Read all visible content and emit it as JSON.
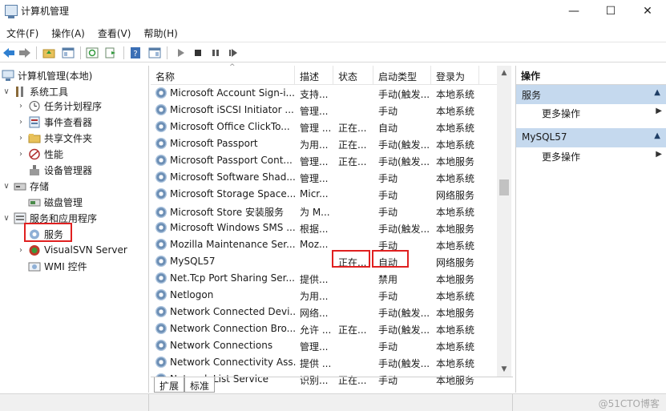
{
  "window": {
    "title": "计算机管理",
    "min_glyph": "—",
    "max_glyph": "☐",
    "close_glyph": "✕"
  },
  "menu": [
    "文件(F)",
    "操作(A)",
    "查看(V)",
    "帮助(H)"
  ],
  "toolbar_icons": [
    "back-icon",
    "forward-icon",
    "up-folder-icon",
    "show-tree-icon",
    "refresh-icon",
    "export-icon",
    "help-icon",
    "view-icon",
    "play-icon",
    "stop-icon",
    "pause-icon",
    "restart-icon"
  ],
  "tree": {
    "root": "计算机管理(本地)",
    "system_tools": "系统工具",
    "task_scheduler": "任务计划程序",
    "event_viewer": "事件查看器",
    "shared_folders": "共享文件夹",
    "performance": "性能",
    "device_manager": "设备管理器",
    "storage": "存储",
    "disk_management": "磁盘管理",
    "services_apps": "服务和应用程序",
    "services": "服务",
    "visualsvn": "VisualSVN Server",
    "wmi": "WMI 控件"
  },
  "columns": {
    "name": "名称",
    "desc": "描述",
    "status": "状态",
    "startup": "启动类型",
    "logon": "登录为"
  },
  "services": [
    {
      "name": "Microsoft Account Sign-i...",
      "desc": "支持...",
      "status": "",
      "startup": "手动(触发...",
      "logon": "本地系统"
    },
    {
      "name": "Microsoft iSCSI Initiator ...",
      "desc": "管理...",
      "status": "",
      "startup": "手动",
      "logon": "本地系统"
    },
    {
      "name": "Microsoft Office ClickTo...",
      "desc": "管理 ...",
      "status": "正在...",
      "startup": "自动",
      "logon": "本地系统"
    },
    {
      "name": "Microsoft Passport",
      "desc": "为用...",
      "status": "正在...",
      "startup": "手动(触发...",
      "logon": "本地系统"
    },
    {
      "name": "Microsoft Passport Cont...",
      "desc": "管理...",
      "status": "正在...",
      "startup": "手动(触发...",
      "logon": "本地服务"
    },
    {
      "name": "Microsoft Software Shad...",
      "desc": "管理...",
      "status": "",
      "startup": "手动",
      "logon": "本地系统"
    },
    {
      "name": "Microsoft Storage Space...",
      "desc": "Micr...",
      "status": "",
      "startup": "手动",
      "logon": "网络服务"
    },
    {
      "name": "Microsoft Store 安装服务",
      "desc": "为 M...",
      "status": "",
      "startup": "手动",
      "logon": "本地系统"
    },
    {
      "name": "Microsoft Windows SMS ...",
      "desc": "根据...",
      "status": "",
      "startup": "手动(触发...",
      "logon": "本地服务"
    },
    {
      "name": "Mozilla Maintenance Ser...",
      "desc": "Moz...",
      "status": "",
      "startup": "手动",
      "logon": "本地系统"
    },
    {
      "name": "MySQL57",
      "desc": "",
      "status": "正在...",
      "startup": "自动",
      "logon": "网络服务"
    },
    {
      "name": "Net.Tcp Port Sharing Ser...",
      "desc": "提供...",
      "status": "",
      "startup": "禁用",
      "logon": "本地服务"
    },
    {
      "name": "Netlogon",
      "desc": "为用...",
      "status": "",
      "startup": "手动",
      "logon": "本地系统"
    },
    {
      "name": "Network Connected Devi...",
      "desc": "网络...",
      "status": "",
      "startup": "手动(触发...",
      "logon": "本地服务"
    },
    {
      "name": "Network Connection Bro...",
      "desc": "允许 ...",
      "status": "正在...",
      "startup": "手动(触发...",
      "logon": "本地系统"
    },
    {
      "name": "Network Connections",
      "desc": "管理...",
      "status": "",
      "startup": "手动",
      "logon": "本地系统"
    },
    {
      "name": "Network Connectivity Ass...",
      "desc": "提供 ...",
      "status": "",
      "startup": "手动(触发...",
      "logon": "本地系统"
    },
    {
      "name": "Network List Service",
      "desc": "识别...",
      "status": "正在...",
      "startup": "手动",
      "logon": "本地服务"
    }
  ],
  "tabs": [
    "扩展",
    "标准"
  ],
  "actions": {
    "title": "操作",
    "section1": "服务",
    "more1": "更多操作",
    "section2": "MySQL57",
    "more2": "更多操作"
  },
  "watermark": "@51CTO博客"
}
